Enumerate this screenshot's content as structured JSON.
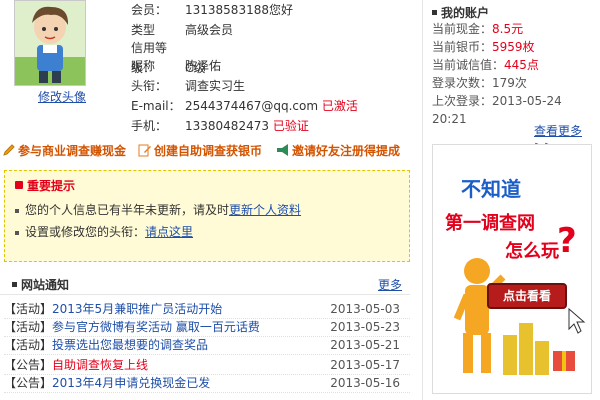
{
  "profile": {
    "edit_avatar": "修改头像",
    "rows": [
      {
        "label": "会员：",
        "value": "13138583188您好"
      },
      {
        "label": "类型",
        "value": "高级会员"
      },
      {
        "label": "信用等级：",
        "value": "C级"
      },
      {
        "label": "昵称",
        "value": "陈泽佑"
      },
      {
        "label": "头衔：",
        "value": "调查实习生"
      },
      {
        "label": "E-mail：",
        "value": "2544374467@qq.com",
        "status": "已激活"
      },
      {
        "label": "手机：",
        "value": "13380482473",
        "status": "已验证"
      }
    ]
  },
  "actions": [
    {
      "label": "参与商业调查赚现金",
      "icon": "pencil-icon"
    },
    {
      "label": "创建自助调查获银币",
      "icon": "edit-icon"
    },
    {
      "label": "邀请好友注册得提成",
      "icon": "megaphone-icon"
    }
  ],
  "notice": {
    "title": "重要提示",
    "line1_text": "您的个人信息已有半年未更新，请及时",
    "line1_link": "更新个人资料",
    "line2_text": "设置或修改您的头衔：",
    "line2_link": "请点这里"
  },
  "news": {
    "title": "网站通知",
    "more": "更多",
    "items": [
      {
        "tag": "【活动】",
        "title": "2013年5月兼职推广员活动开始",
        "date": "2013-05-03",
        "title_color": "#1f4fa8"
      },
      {
        "tag": "【活动】",
        "title": "参与官方微博有奖活动 赢取一百元话费",
        "date": "2013-05-23",
        "title_color": "#1f4fa8"
      },
      {
        "tag": "【活动】",
        "title": "投票选出您最想要的调查奖品",
        "date": "2013-05-21",
        "title_color": "#1f4fa8"
      },
      {
        "tag": "【公告】",
        "title": "自助调查恢复上线",
        "date": "2013-05-17",
        "title_color": "#e3001b"
      },
      {
        "tag": "【公告】",
        "title": "2013年4月申请兑换现金已发",
        "date": "2013-05-16",
        "title_color": "#1f4fa8"
      }
    ]
  },
  "account": {
    "title": "我的账户",
    "rows": [
      {
        "label": "当前现金：",
        "value": "8.5元",
        "red": true
      },
      {
        "label": "当前银币：",
        "value": "5959枚",
        "red": true
      },
      {
        "label": "当前诚信值：",
        "value": "445点",
        "red": true
      },
      {
        "label": "登录次数：",
        "value": "179次",
        "red": false
      },
      {
        "label": "上次登录：",
        "value": "2013-05-24 20:21",
        "red": false
      }
    ],
    "more": "查看更多>>"
  },
  "ad": {
    "line1": "不知道",
    "line2": "第一调查网",
    "line3": "怎么玩",
    "question_mark": "?",
    "button": "点击看看"
  }
}
